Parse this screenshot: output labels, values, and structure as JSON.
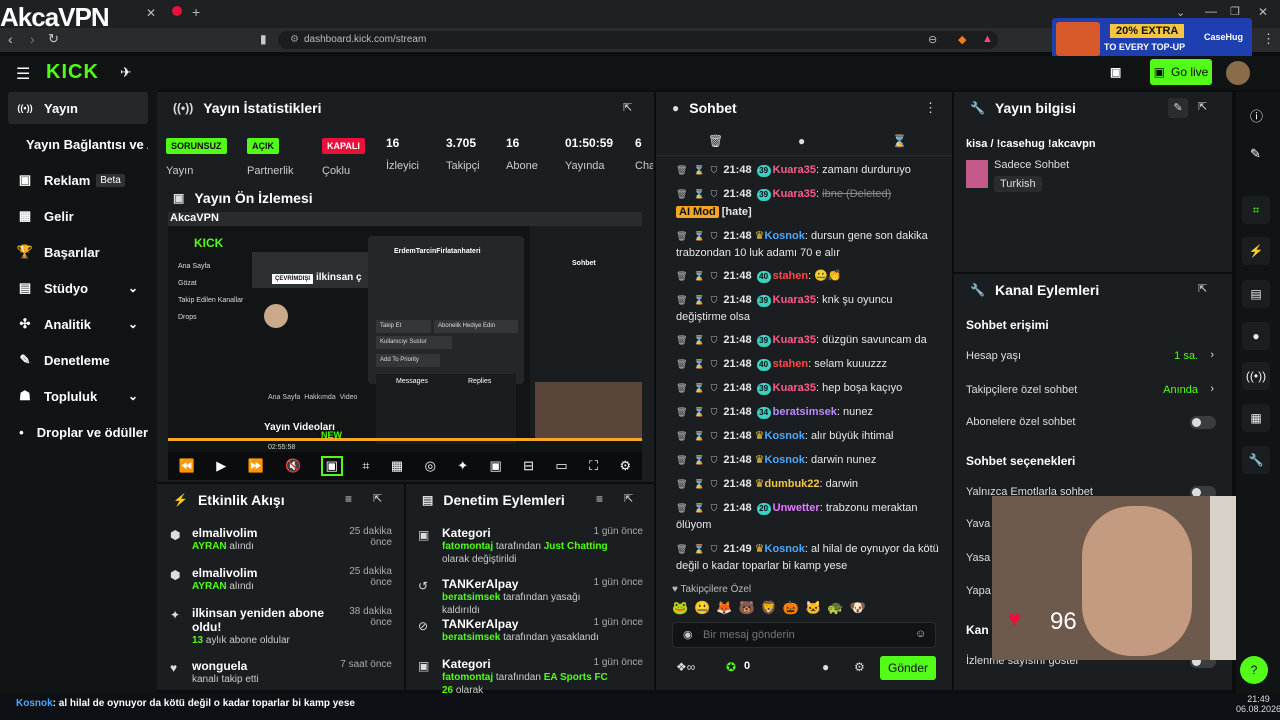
{
  "watermark": "AkcaVPN",
  "browser": {
    "url": "dashboard.kick.com/stream"
  },
  "ad": {
    "line1": "20% EXTRA",
    "line2": "TO EVERY TOP-UP",
    "brand": "CaseHug"
  },
  "topnav": {
    "logo": "KICK",
    "golive": "Go live"
  },
  "sidebar": {
    "items": [
      {
        "label": "Yayın",
        "icon": "((•))"
      },
      {
        "label": "Yayın Bağlantısı ve Anahtarı",
        "icon": ""
      },
      {
        "label": "Reklam",
        "icon": "▣",
        "badge": "Beta"
      },
      {
        "label": "Gelir",
        "icon": "▦"
      },
      {
        "label": "Başarılar",
        "icon": "🏆"
      },
      {
        "label": "Stüdyo",
        "icon": "▤"
      },
      {
        "label": "Analitik",
        "icon": "✣"
      },
      {
        "label": "Denetleme",
        "icon": "✎"
      },
      {
        "label": "Topluluk",
        "icon": "☗"
      },
      {
        "label": "Droplar ve ödüller",
        "icon": "•"
      }
    ]
  },
  "stats": {
    "title": "Yayın İstatistikleri",
    "b1": "SORUNSUZ",
    "b1l": "Yayın",
    "b2": "AÇIK",
    "b2l": "Partnerlik",
    "b3": "KAPALI",
    "b3l": "Çoklu",
    "v1": "16",
    "l1": "İzleyici",
    "v2": "3.705",
    "l2": "Takipçi",
    "v3": "16",
    "l3": "Abone",
    "v4": "01:50:59",
    "l4": "Yayında",
    "v5": "6",
    "l5": "Cha"
  },
  "preview": {
    "title": "Yayın Ön İzlemesi",
    "profile_name": "ErdemTarcinFirlatanhateri",
    "follow": "Takip Et",
    "subgift": "Abonelik Hediye Edin",
    "mute": "Kullanıcıyı Sustur",
    "priority": "Add To Priority",
    "messages": "Messages",
    "replies": "Replies",
    "chat": "Sohbet",
    "nav1": "Ana Sayfa",
    "nav2": "Gözat",
    "nav3": "Takip Edilen Kanallar",
    "nav4": "Drops",
    "tab1": "Ana Sayfa",
    "tab2": "Hakkımda",
    "tab3": "Video",
    "videos": "Yayın Videoları",
    "new_badge": "NEW",
    "time": "02:55:58",
    "streamer": "ilkinsan ç",
    "offline": "ÇEVRİMDIŞI"
  },
  "chat": {
    "title": "Sohbet",
    "lines": [
      {
        "time": "21:48",
        "lvl": "39",
        "user": "Kuara35",
        "color": "#ff5c8a",
        "msg": "zamanı durduruyo"
      },
      {
        "time": "21:48",
        "lvl": "39",
        "user": "Kuara35",
        "color": "#ff5c8a",
        "msg": "ibne (Deleted)"
      },
      {
        "mod": "AI Mod",
        "tag": "[hate]"
      },
      {
        "time": "21:48",
        "user": "Kosnok",
        "color": "#4aa8ff",
        "msg": "dursun gene son dakika trabzondan 10 luk adamı 70 e alır"
      },
      {
        "time": "21:48",
        "lvl": "40",
        "user": "stahen",
        "color": "#ff4a4a",
        "msg": "🤐👏"
      },
      {
        "time": "21:48",
        "lvl": "39",
        "user": "Kuara35",
        "color": "#ff5c8a",
        "msg": "knk şu oyuncu değiştirme olsa"
      },
      {
        "time": "21:48",
        "lvl": "39",
        "user": "Kuara35",
        "color": "#ff5c8a",
        "msg": "düzgün savuncam da"
      },
      {
        "time": "21:48",
        "lvl": "40",
        "user": "stahen",
        "color": "#ff4a4a",
        "msg": "selam kuuuzzz"
      },
      {
        "time": "21:48",
        "lvl": "39",
        "user": "Kuara35",
        "color": "#ff5c8a",
        "msg": "hep boşa kaçıyo"
      },
      {
        "time": "21:48",
        "lvl": "34",
        "user": "beratsimsek",
        "color": "#b98bff",
        "msg": "nunez"
      },
      {
        "time": "21:48",
        "user": "Kosnok",
        "color": "#4aa8ff",
        "msg": "alır büyük ihtimal"
      },
      {
        "time": "21:48",
        "user": "Kosnok",
        "color": "#4aa8ff",
        "msg": "darwin nunez"
      },
      {
        "time": "21:48",
        "user": "dumbuk22",
        "color": "#f5c542",
        "msg": "darwin"
      },
      {
        "time": "21:48",
        "lvl": "20",
        "user": "Unwetter",
        "color": "#e27cff",
        "msg": "trabzonu meraktan ölüyom"
      },
      {
        "time": "21:49",
        "user": "Kosnok",
        "color": "#4aa8ff",
        "msg": "al hilal de oynuyor da kötü değil o kadar toparlar bi kamp yese"
      }
    ],
    "follower_only": "Takipçilere Özel",
    "placeholder": "Bir mesaj gönderin",
    "count": "0",
    "send": "Gönder"
  },
  "info": {
    "title": "Yayın bilgisi",
    "stream_title": "kisa / !casehug !akcavpn",
    "category": "Sadece Sohbet",
    "language": "Turkish"
  },
  "channel": {
    "title": "Kanal Eylemleri",
    "sec1": "Sohbet erişimi",
    "r1": "Hesap yaşı",
    "r1v": "1 sa.",
    "r2": "Takipçilere özel sohbet",
    "r2v": "Anında",
    "r3": "Abonelere özel sohbet",
    "sec2": "Sohbet seçenekleri",
    "r4": "Yalnızca Emotlarla sohbet",
    "r5": "Yava",
    "r6": "Yasa",
    "r7": "Yapa",
    "sec3": "Kan",
    "r8": "İzlenme sayısını göster"
  },
  "activity": {
    "title": "Etkinlik Akışı",
    "items": [
      {
        "name": "elmalivolim",
        "sub": "AYRAN",
        "rest": " alındı",
        "time": "25 dakika önce"
      },
      {
        "name": "elmalivolim",
        "sub": "AYRAN",
        "rest": " alındı",
        "time": "25 dakika önce"
      },
      {
        "name": "ilkinsan yeniden abone oldu!",
        "sub": "13",
        "rest": " aylık abone oldular",
        "time": "38 dakika önce"
      },
      {
        "name": "wonguela",
        "sub": "",
        "rest": "kanalı takip etti",
        "time": "7 saat önce"
      }
    ]
  },
  "moderation": {
    "title": "Denetim Eylemleri",
    "items": [
      {
        "name": "Kategori",
        "user": "fatomontaj",
        "mid": " tarafından ",
        "val": "Just Chatting",
        "rest": " olarak değiştirildi",
        "time": "1 gün önce"
      },
      {
        "name": "TANKerAlpay",
        "user": "beratsimsek",
        "mid": " tarafından yasağı kaldırıldı",
        "val": "",
        "rest": "",
        "time": "1 gün önce"
      },
      {
        "name": "TANKerAlpay",
        "user": "beratsimsek",
        "mid": " tarafından yasaklandı",
        "val": "",
        "rest": "",
        "time": "1 gün önce"
      },
      {
        "name": "Kategori",
        "user": "fatomontaj",
        "mid": " tarafından ",
        "val": "EA Sports FC 26",
        "rest": " olarak",
        "time": "1 gün önce"
      }
    ]
  },
  "heart_rate": "96",
  "ticker": {
    "user": "Kosnok",
    "msg": ": al hilal de oynuyor da kötü değil o kadar toparlar bi kamp yese"
  },
  "clock": {
    "time": "21:49",
    "date": "06.08.2026"
  }
}
